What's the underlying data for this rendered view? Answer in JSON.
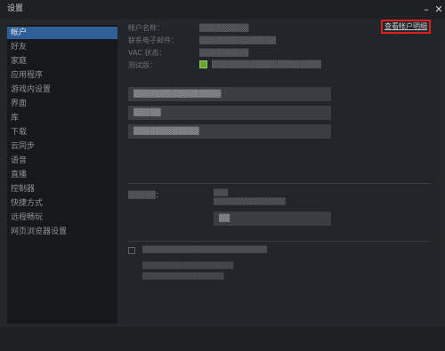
{
  "window": {
    "title": "设置",
    "minimize_glyph": "–",
    "close_glyph": "✕"
  },
  "sidebar": {
    "items": [
      {
        "label": "帐户",
        "active": true
      },
      {
        "label": "好友"
      },
      {
        "label": "家庭"
      },
      {
        "label": "应用程序"
      },
      {
        "label": "游戏内设置"
      },
      {
        "label": "界面"
      },
      {
        "label": "库"
      },
      {
        "label": "下载"
      },
      {
        "label": "云同步"
      },
      {
        "label": "语音"
      },
      {
        "label": "直播"
      },
      {
        "label": "控制器"
      },
      {
        "label": "快捷方式"
      },
      {
        "label": "远程畅玩"
      },
      {
        "label": "网页浏览器设置"
      }
    ]
  },
  "account": {
    "view_account_details": "查看帐户明细",
    "fields": [
      {
        "label": "帐户名称：",
        "value": "▒▒▒▒▒▒▒▒▒"
      },
      {
        "label": "联系电子邮件：",
        "value": "▒▒▒▒▒▒▒▒▒▒▒▒▒▒"
      },
      {
        "label": "VAC 状态：",
        "value": "▒▒▒▒▒▒▒▒▒"
      },
      {
        "label": "测试版：",
        "value": ""
      }
    ],
    "beta_checkbox_label": "▒▒▒▒▒▒▒▒▒▒▒▒▒▒▒▒▒▒▒▒"
  },
  "actions": [
    {
      "label": "▒▒▒▒▒▒▒▒▒▒▒▒▒▒▒▒"
    },
    {
      "label": "▒▒▒▒▒"
    },
    {
      "label": "▒▒▒▒▒▒▒▒▒▒▒▒"
    }
  ],
  "security": {
    "label": "▒▒▒▒▒：",
    "line1": "▒▒▒",
    "line2": "▒▒▒▒▒▒▒▒▒▒▒▒▒▒▒",
    "button": "▒▒"
  },
  "option": {
    "label": "▒▒▒▒▒▒▒▒▒▒▒▒▒▒▒▒▒▒▒▒▒▒▒▒▒▒",
    "desc1": "▒▒▒▒▒▒▒▒▒▒▒▒▒▒▒▒▒▒▒",
    "desc2": "▒▒▒▒▒▒▒▒▒▒▒▒▒▒▒▒▒"
  },
  "colors": {
    "highlight_box": "#e02020",
    "active_item": "#2f5f97",
    "checkbox_green": "#6aa33a"
  }
}
